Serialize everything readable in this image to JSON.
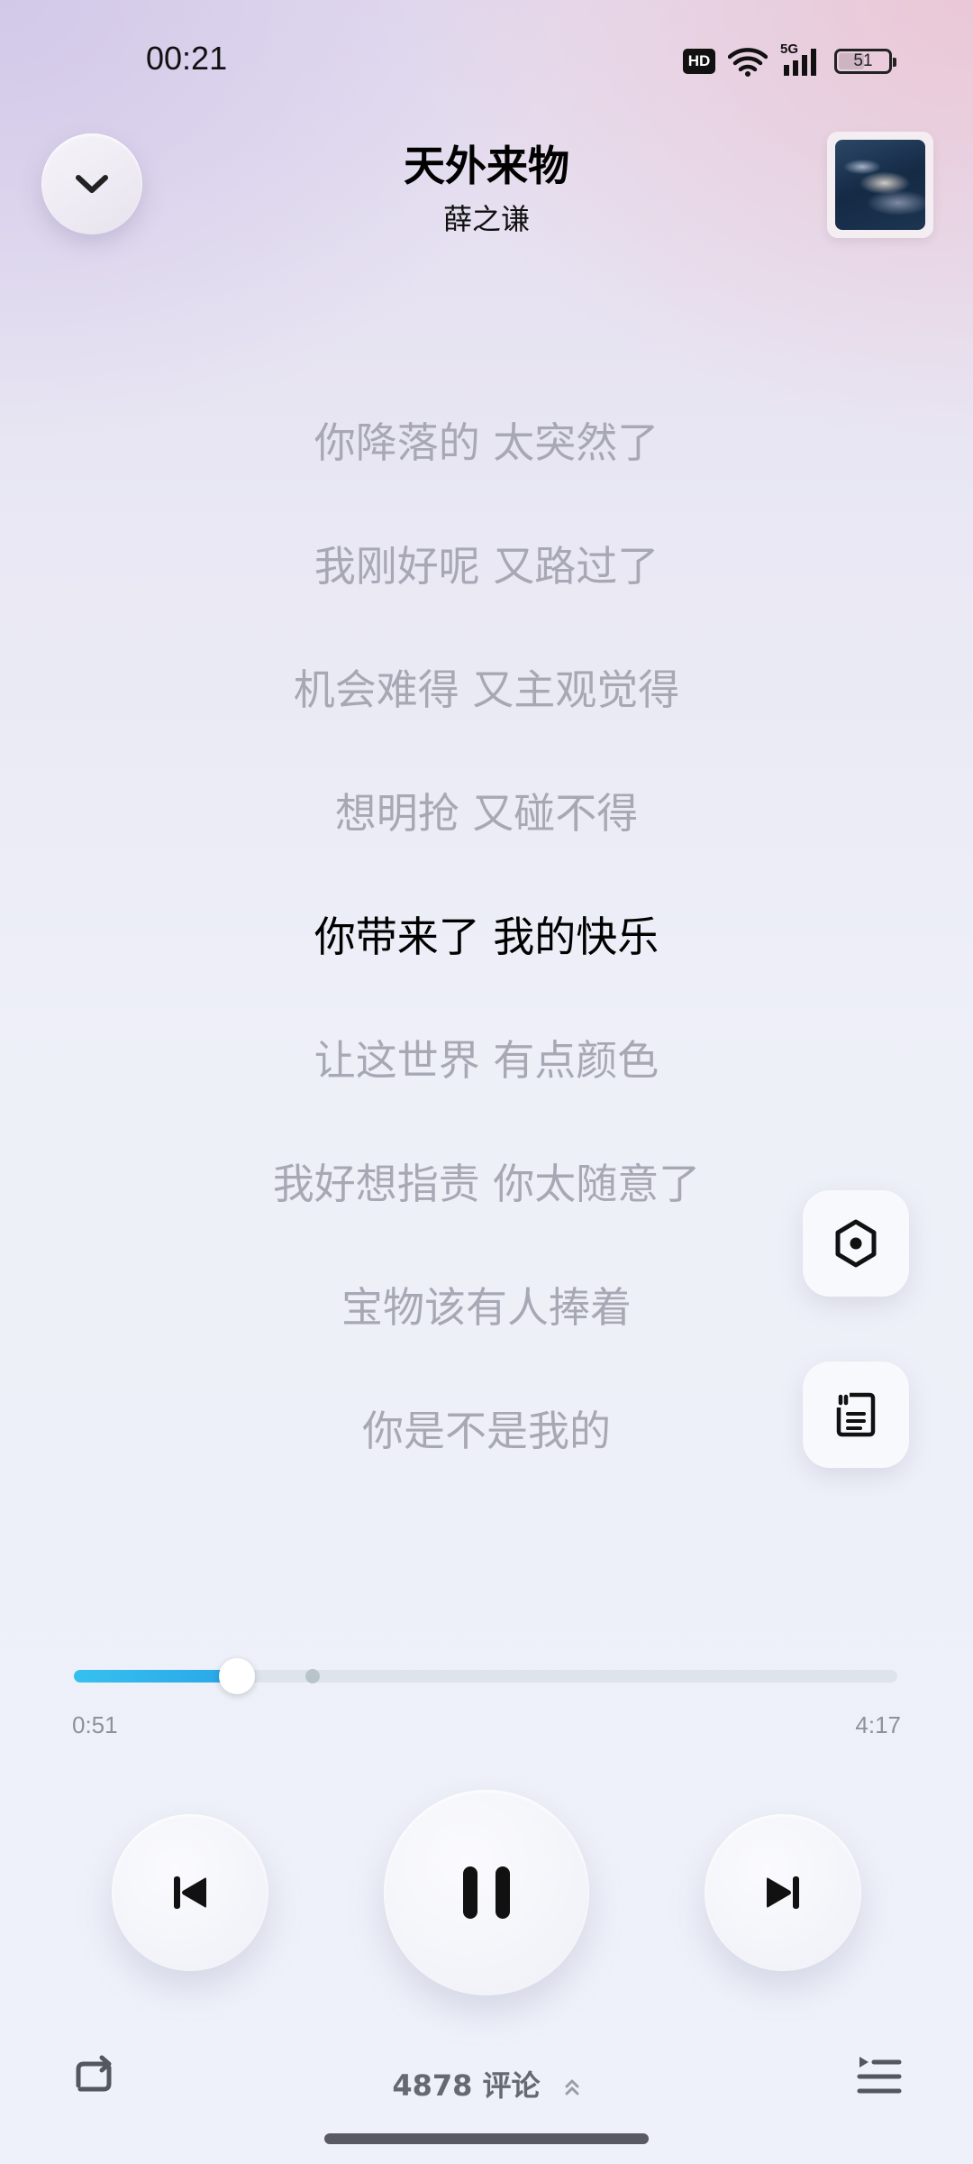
{
  "status_bar": {
    "time": "00:21",
    "hd_label": "HD",
    "network": "5G",
    "battery_level": "51"
  },
  "header": {
    "title": "天外来物",
    "artist": "薛之谦"
  },
  "lyrics": [
    "你降落的 太突然了",
    "我刚好呢 又路过了",
    "机会难得 又主观觉得",
    "想明抢 又碰不得",
    "你带来了 我的快乐",
    "让这世界 有点颜色",
    "我好想指责 你太随意了",
    "宝物该有人捧着",
    "你是不是我的"
  ],
  "active_lyric_index": 4,
  "player": {
    "current_time": "0:51",
    "total_time": "4:17",
    "progress_fraction": 0.198,
    "buffered_fraction": 0.29
  },
  "comments": {
    "count": "4878",
    "label": "评论"
  },
  "icons": {
    "collapse": "chevron-down-icon",
    "effect": "hexagon-icon",
    "lyrics_poster": "quote-card-icon",
    "previous": "skip-previous-icon",
    "play_pause": "pause-icon",
    "next": "skip-next-icon",
    "repeat": "repeat-icon",
    "playlist": "playlist-icon",
    "comments_expand": "chevron-up-icon"
  },
  "colors": {
    "progress_accent": "#2fb4ec",
    "lyric_inactive": "#a7a8b4",
    "lyric_active": "#000000"
  }
}
